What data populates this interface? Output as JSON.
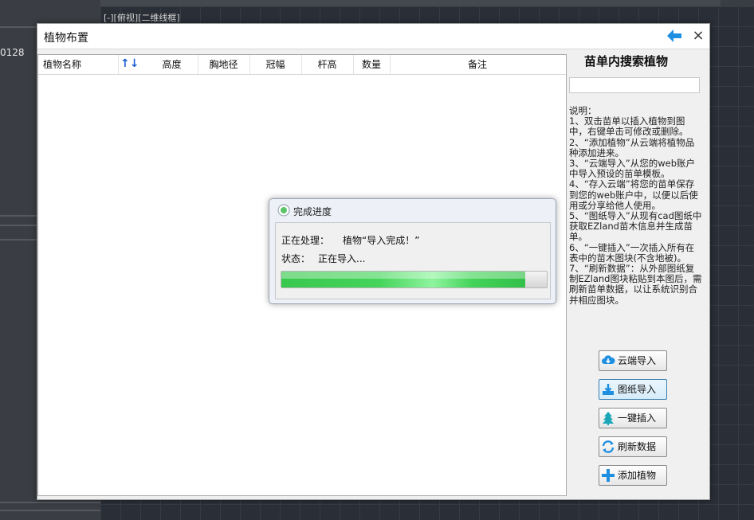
{
  "background": {
    "left_panel_text": "0128",
    "viewport_label": "[-][俯视][二维线框]"
  },
  "dialog": {
    "title": "植物布置",
    "back_icon": "arrow-left-icon",
    "close_symbol": "×"
  },
  "table": {
    "columns": [
      "植物名称",
      "高度",
      "胸地径",
      "冠幅",
      "杆高",
      "数量",
      "备注"
    ],
    "sort_arrows": "↑↓",
    "rows": []
  },
  "right_panel": {
    "search_title": "苗单内搜索植物",
    "search_value": "",
    "notes": [
      "说明：",
      "1、双击苗单以插入植物到图中，右键单击可修改或删除。",
      "2、“添加植物”从云端将植物品种添加进来。",
      "3、“云端导入”从您的web账户中导入预设的苗单模板。",
      "4、“存入云端”将您的苗单保存到您的web账户中，以便以后使用或分享给他人使用。",
      "5、“图纸导入”从现有cad图纸中获取EZland苗木信息并生成苗单。",
      "6、“一键插入”一次插入所有在表中的苗木图块(不含地被)。",
      "7、“刷新数据”：从外部图纸复制EZland图块粘贴到本图后，需刷新苗单数据，以让系统识别合并相应图块。"
    ],
    "buttons": [
      {
        "label": "云端导入",
        "icon": "cloud-download-icon"
      },
      {
        "label": "图纸导入",
        "icon": "import-drawing-icon"
      },
      {
        "label": "一键插入",
        "icon": "tree-icon"
      },
      {
        "label": "刷新数据",
        "icon": "refresh-icon"
      },
      {
        "label": "添加植物",
        "icon": "plus-icon"
      }
    ]
  },
  "progress": {
    "title": "完成进度",
    "processing_label": "正在处理：",
    "processing_value": "植物“导入完成！”",
    "status_label": "状态：",
    "status_value": "正在导入...",
    "percent": 92,
    "colors": {
      "fill": "#44d45a"
    }
  }
}
